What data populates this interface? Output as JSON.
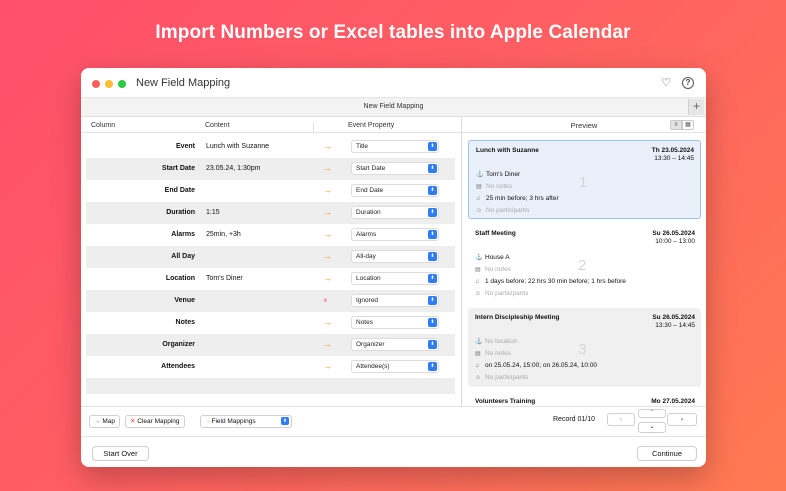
{
  "headline": "Import Numbers or Excel tables into Apple Calendar",
  "window": {
    "title": "New Field Mapping",
    "tab_title": "New Field Mapping",
    "tab_add": "+"
  },
  "columns": {
    "column": "Column",
    "content": "Content",
    "event_property": "Event Property"
  },
  "rows": [
    {
      "column": "Event",
      "content": "Lunch with Suzanne",
      "arrow": "→",
      "property": "Title"
    },
    {
      "column": "Start Date",
      "content": "23.05.24, 1:30pm",
      "arrow": "→",
      "property": "Start Date"
    },
    {
      "column": "End Date",
      "content": "",
      "arrow": "→",
      "property": "End Date"
    },
    {
      "column": "Duration",
      "content": "1:15",
      "arrow": "→",
      "property": "Duration"
    },
    {
      "column": "Alarms",
      "content": "25min, +3h",
      "arrow": "→",
      "property": "Alarms"
    },
    {
      "column": "All Day",
      "content": "",
      "arrow": "→",
      "property": "All-day"
    },
    {
      "column": "Location",
      "content": "Tom's Diner",
      "arrow": "→",
      "property": "Location"
    },
    {
      "column": "Venue",
      "content": "",
      "arrow": "×",
      "property": "Ignored"
    },
    {
      "column": "Notes",
      "content": "",
      "arrow": "→",
      "property": "Notes"
    },
    {
      "column": "Organizer",
      "content": "",
      "arrow": "→",
      "property": "Organizer"
    },
    {
      "column": "Attendees",
      "content": "",
      "arrow": "→",
      "property": "Attendee(s)"
    }
  ],
  "preview": {
    "title": "Preview",
    "cards": [
      {
        "title": "Lunch with Suzanne",
        "date": "Th 23.05.2024",
        "time": "13:30 – 14:45",
        "location": "Tom's Diner",
        "notes": "No notes",
        "alarms": "25 min before; 3 hrs after",
        "participants": "No participants",
        "number": "1"
      },
      {
        "title": "Staff Meeting",
        "date": "Su 26.05.2024",
        "time": "10:00 – 13:00",
        "location": "House A",
        "notes": "No notes",
        "alarms": "1 days before; 22 hrs 30 min before; 1 hrs before",
        "participants": "No participants",
        "number": "2"
      },
      {
        "title": "Intern Discipleship Meeting",
        "date": "Su 26.05.2024",
        "time": "13:30 – 14:45",
        "location": "No location",
        "notes": "No notes",
        "alarms": "on 25.05.24, 15:00; on 26.05.24, 10:00",
        "participants": "No participants",
        "number": "3"
      },
      {
        "title": "Volunteers Training",
        "date": "Mo 27.05.2024"
      }
    ]
  },
  "footer": {
    "map": "Map",
    "clear_mapping": "Clear Mapping",
    "field_mappings": "Field Mappings",
    "record": "Record 01/10"
  },
  "bottom": {
    "start_over": "Start Over",
    "continue": "Continue"
  },
  "colors": {
    "accent": "#2f7cf6",
    "arrow": "#f5921e",
    "ignored": "#e86a5a",
    "selected_card": "#eaf0fa"
  }
}
